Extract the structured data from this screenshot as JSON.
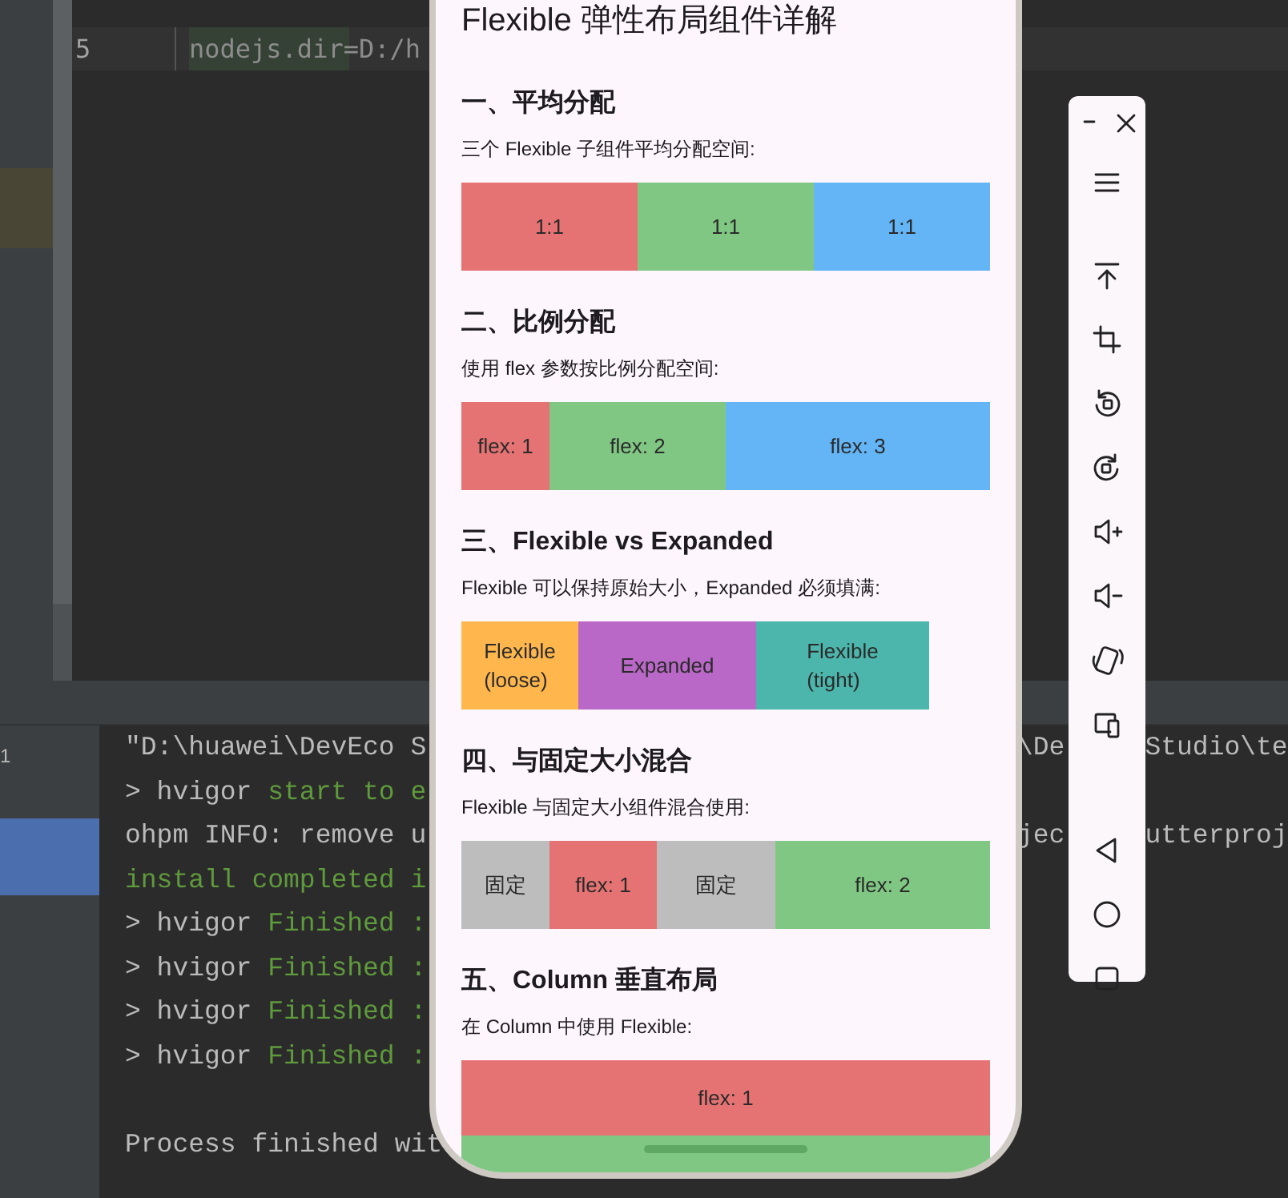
{
  "editor": {
    "lines": [
      {
        "number": "5",
        "text": "nodejs.dir=D:/h",
        "selected": true
      }
    ]
  },
  "terminal": {
    "gutter_label": "1",
    "lines": [
      {
        "segments": [
          {
            "text": "\"D:\\huawei\\DevEco S",
            "kind": "plain"
          }
        ],
        "right": [
          "\\De",
          "Studio\\te"
        ]
      },
      {
        "segments": [
          {
            "text": "> hvigor ",
            "kind": "plain"
          },
          {
            "text": "start to e",
            "kind": "success"
          }
        ]
      },
      {
        "segments": [
          {
            "text": "ohpm INFO: remove u",
            "kind": "plain"
          }
        ],
        "right": [
          "jec",
          "utterproj"
        ]
      },
      {
        "segments": [
          {
            "text": "install completed i",
            "kind": "success"
          }
        ]
      },
      {
        "segments": [
          {
            "text": "> hvigor ",
            "kind": "plain"
          },
          {
            "text": "Finished :",
            "kind": "success"
          }
        ]
      },
      {
        "segments": [
          {
            "text": "> hvigor ",
            "kind": "plain"
          },
          {
            "text": "Finished :",
            "kind": "success"
          }
        ]
      },
      {
        "segments": [
          {
            "text": "> hvigor ",
            "kind": "plain"
          },
          {
            "text": "Finished :",
            "kind": "success"
          }
        ]
      },
      {
        "segments": [
          {
            "text": "> hvigor ",
            "kind": "plain"
          },
          {
            "text": "Finished :",
            "kind": "success"
          }
        ]
      },
      {
        "kind": "blank"
      },
      {
        "segments": [
          {
            "text": "Process finished wit",
            "kind": "plain"
          }
        ]
      }
    ]
  },
  "phone": {
    "title": "Flexible 弹性布局组件详解",
    "sections": [
      {
        "heading": "一、平均分配",
        "description": "三个 Flexible 子组件平均分配空间:",
        "kind": "row",
        "segments": [
          {
            "label": "1:1",
            "color": "#e57373"
          },
          {
            "label": "1:1",
            "color": "#81c784"
          },
          {
            "label": "1:1",
            "color": "#64b5f6"
          }
        ]
      },
      {
        "heading": "二、比例分配",
        "description": "使用 flex 参数按比例分配空间:",
        "kind": "row",
        "segments": [
          {
            "label": "flex: 1",
            "color": "#e57373"
          },
          {
            "label": "flex: 2",
            "color": "#81c784"
          },
          {
            "label": "flex: 3",
            "color": "#64b5f6"
          }
        ]
      },
      {
        "heading": "三、Flexible vs Expanded",
        "description": "Flexible 可以保持原始大小，Expanded 必须填满:",
        "kind": "row",
        "segments": [
          {
            "label": "Flexible (loose)",
            "color": "#ffb74d"
          },
          {
            "label": "Expanded",
            "color": "#ba68c8"
          },
          {
            "label": "Flexible (tight)",
            "color": "#4db6ac"
          }
        ]
      },
      {
        "heading": "四、与固定大小混合",
        "description": "Flexible 与固定大小组件混合使用:",
        "kind": "row",
        "segments": [
          {
            "label": "固定",
            "color": "#bdbdbd"
          },
          {
            "label": "flex: 1",
            "color": "#e57373"
          },
          {
            "label": "固定",
            "color": "#bdbdbd"
          },
          {
            "label": "flex: 2",
            "color": "#81c784"
          }
        ]
      },
      {
        "heading": "五、Column 垂直布局",
        "description": "在 Column 中使用 Flexible:",
        "kind": "column",
        "segments": [
          {
            "label": "flex: 1",
            "color": "#e57373"
          },
          {
            "color": "#81c784"
          }
        ]
      }
    ]
  },
  "toolbar": {
    "buttons": [
      {
        "kind": "minimize"
      },
      {
        "kind": "close"
      },
      {
        "kind": "menu"
      },
      {
        "kind": "divider"
      },
      {
        "kind": "top"
      },
      {
        "kind": "crop"
      },
      {
        "kind": "rotate-left"
      },
      {
        "kind": "rotate-right"
      },
      {
        "kind": "volume-up"
      },
      {
        "kind": "volume-down"
      },
      {
        "kind": "shake"
      },
      {
        "kind": "devices"
      },
      {
        "kind": "divider"
      },
      {
        "kind": "back"
      },
      {
        "kind": "home"
      },
      {
        "kind": "recent"
      }
    ]
  }
}
